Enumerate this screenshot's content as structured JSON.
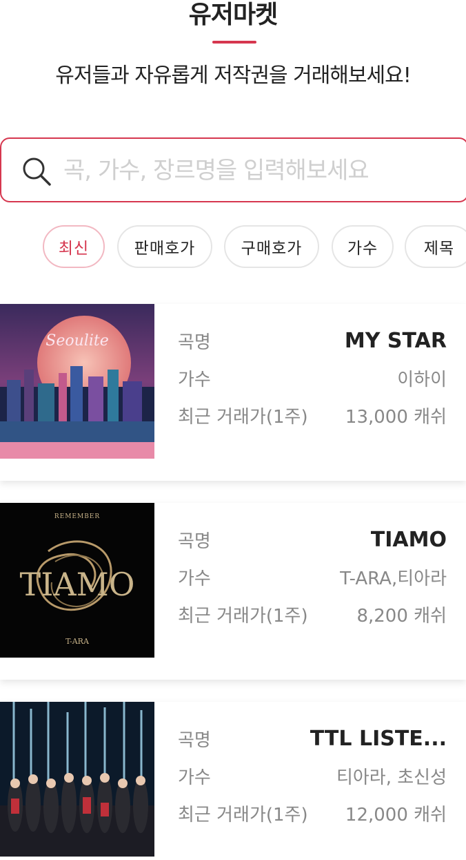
{
  "header": {
    "title": "유저마켓",
    "subtitle": "유저들과 자유롭게 저작권을 거래해보세요!"
  },
  "search": {
    "placeholder": "곡, 가수, 장르명을 입력해보세요"
  },
  "filters": [
    {
      "label": "최신",
      "active": true
    },
    {
      "label": "판매호가",
      "active": false
    },
    {
      "label": "구매호가",
      "active": false
    },
    {
      "label": "가수",
      "active": false
    },
    {
      "label": "제목",
      "active": false
    }
  ],
  "labels": {
    "song": "곡명",
    "artist": "가수",
    "recent_price": "최근 거래가(1주)"
  },
  "items": [
    {
      "title": "MY STAR",
      "artist": "이하이",
      "price": "13,000 캐쉬",
      "cover_text": "Seoulite"
    },
    {
      "title": "TIAMO",
      "artist": "T-ARA,티아라",
      "price": "8,200 캐쉬",
      "cover_text": "TIAMO",
      "cover_top": "REMEMBER",
      "cover_bottom": "T-ARA"
    },
    {
      "title": "TTL LISTE...",
      "artist": "티아라, 초신성",
      "price": "12,000 캐쉬"
    }
  ],
  "colors": {
    "accent": "#d6374f",
    "chip_active_border": "#f2b8c2"
  }
}
